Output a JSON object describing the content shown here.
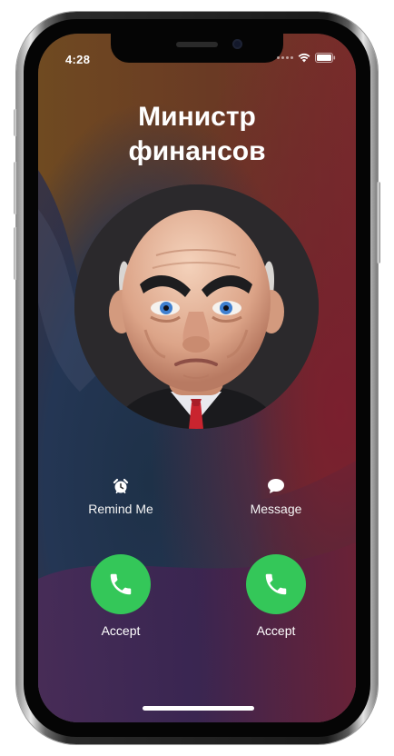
{
  "status_bar": {
    "time": "4:28"
  },
  "call": {
    "caller_name_line1": "Министр",
    "caller_name_line2": "финансов"
  },
  "actions": {
    "remind_label": "Remind Me",
    "remind_icon": "alarm-clock-icon",
    "message_label": "Message",
    "message_icon": "speech-bubble-icon"
  },
  "accept_buttons": [
    {
      "label": "Accept",
      "icon": "phone-handset-icon"
    },
    {
      "label": "Accept",
      "icon": "phone-handset-icon"
    }
  ],
  "colors": {
    "accept_green": "#34c759",
    "text_white": "#ffffff"
  }
}
